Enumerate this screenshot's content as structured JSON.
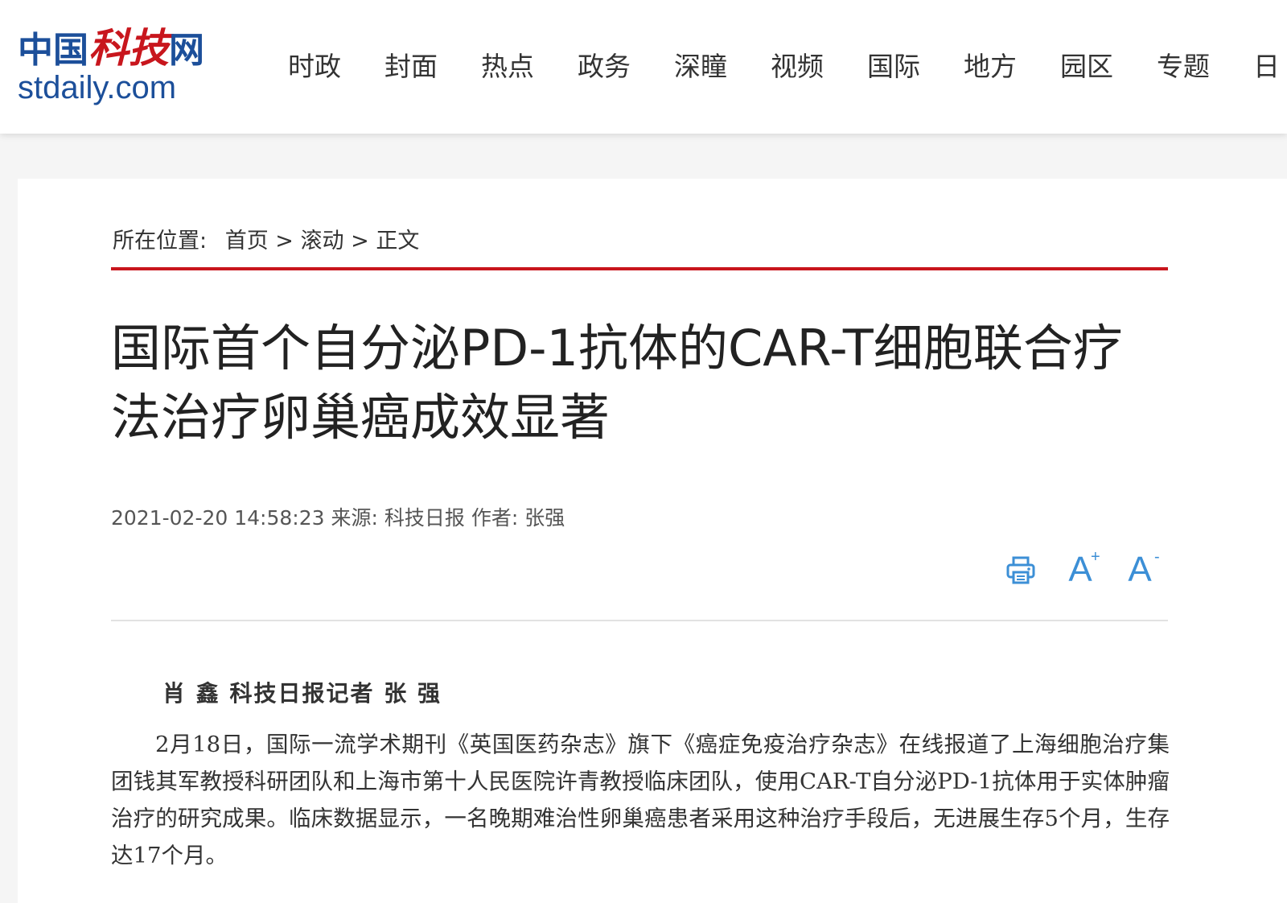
{
  "header": {
    "logo_cn_prefix": "中国",
    "logo_cn_brand": "科技",
    "logo_cn_suffix": "网",
    "logo_en": "stdaily.com",
    "nav_items": [
      "时政",
      "封面",
      "热点",
      "政务",
      "深瞳",
      "视频",
      "国际",
      "地方",
      "园区",
      "专题",
      "日"
    ]
  },
  "breadcrumb": {
    "label": "所在位置:",
    "items": [
      "首页",
      "滚动",
      "正文"
    ],
    "separator": ">"
  },
  "article": {
    "title": "国际首个自分泌PD-1抗体的CAR-T细胞联合疗法治疗卵巢癌成效显著",
    "datetime": "2021-02-20 14:58:23",
    "source_label": "来源:",
    "source": "科技日报",
    "author_label": "作者:",
    "author": "张强",
    "byline": "肖 鑫 科技日报记者 张 强",
    "paragraph": "2月18日，国际一流学术期刊《英国医药杂志》旗下《癌症免疫治疗杂志》在线报道了上海细胞治疗集团钱其军教授科研团队和上海市第十人民医院许青教授临床团队，使用CAR-T自分泌PD-1抗体用于实体肿瘤治疗的研究成果。临床数据显示，一名晚期难治性卵巢癌患者采用这种治疗手段后，无进展生存5个月，生存达17个月。"
  },
  "tools": {
    "print_icon": "printer-icon",
    "font_increase_glyph": "A",
    "font_increase_mark": "+",
    "font_decrease_glyph": "A",
    "font_decrease_mark": "-"
  },
  "colors": {
    "brand_blue": "#1c4f9a",
    "brand_red": "#c8161d",
    "tool_blue": "#3c8fd6"
  }
}
